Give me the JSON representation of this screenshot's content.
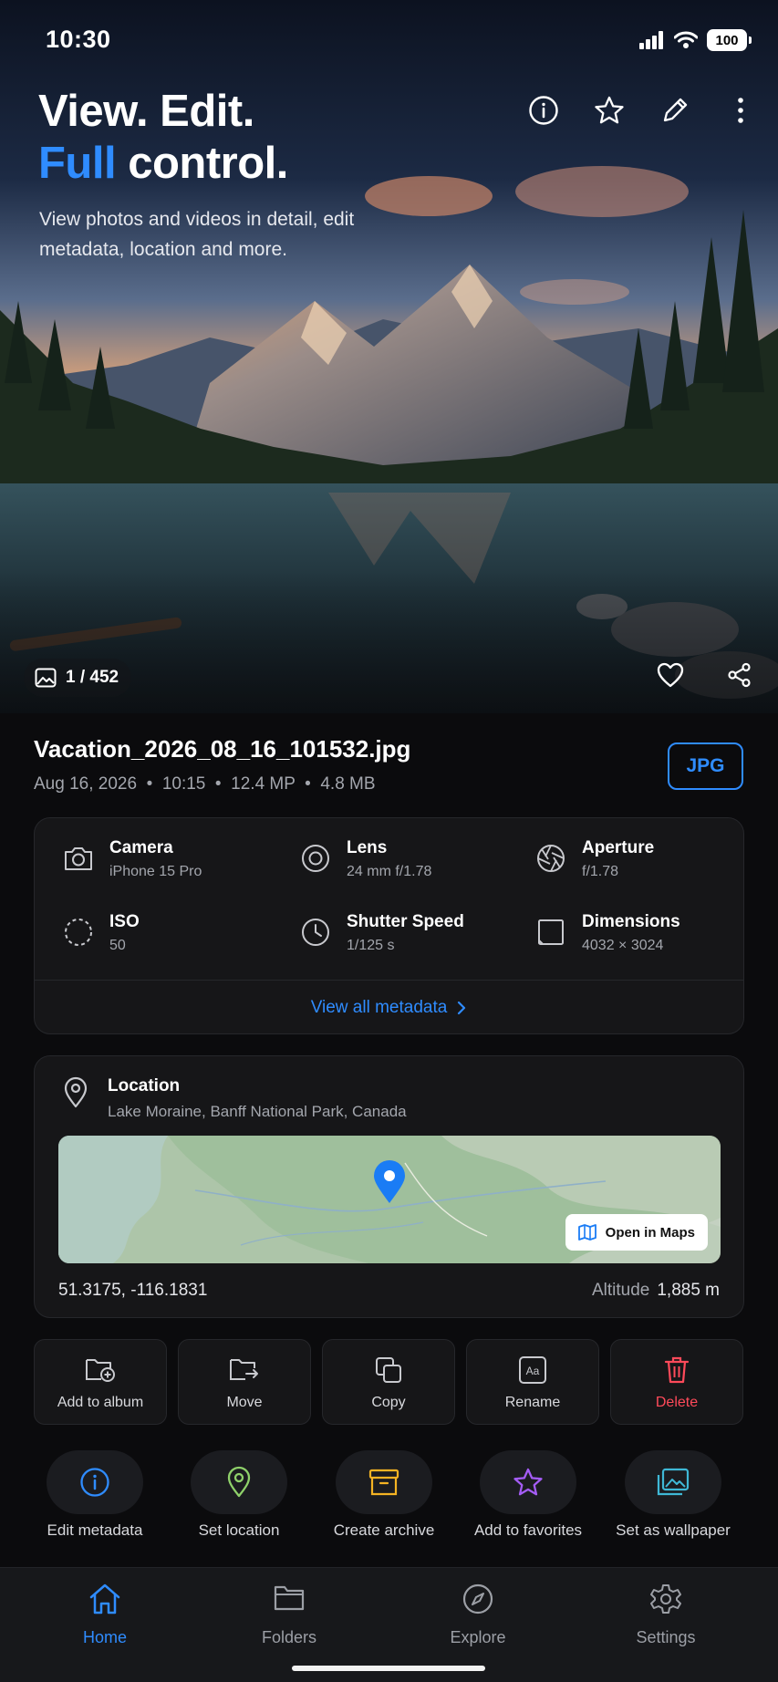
{
  "status_bar": {
    "time": "10:30",
    "battery": "100"
  },
  "hero": {
    "headline_line1": "View. Edit.",
    "headline_accent": "Full",
    "headline_rest": " control.",
    "subtitle": "View photos and videos in detail, edit metadata, location and more.",
    "counter": "1 / 452",
    "top_icons": [
      "info-icon",
      "star-icon",
      "pencil-icon",
      "more-vertical-icon"
    ],
    "bottom_icons": [
      "heart-icon",
      "share-icon"
    ]
  },
  "file": {
    "name": "Vacation_2026_08_16_101532.jpg",
    "date": "Aug 16, 2026",
    "time": "10:15",
    "megapixels": "12.4 MP",
    "size": "4.8 MB",
    "format": "JPG"
  },
  "metadata": {
    "items": [
      {
        "label": "Camera",
        "value": "iPhone 15 Pro",
        "icon": "camera-icon"
      },
      {
        "label": "Lens",
        "value": "24 mm f/1.78",
        "icon": "lens-icon"
      },
      {
        "label": "Aperture",
        "value": "f/1.78",
        "icon": "aperture-icon"
      },
      {
        "label": "ISO",
        "value": "50",
        "icon": "iso-icon"
      },
      {
        "label": "Shutter Speed",
        "value": "1/125 s",
        "icon": "clock-icon"
      },
      {
        "label": "Dimensions",
        "value": "4032 × 3024",
        "icon": "dimensions-icon"
      }
    ],
    "view_all": "View all metadata"
  },
  "location": {
    "title": "Location",
    "address": "Lake Moraine, Banff National Park, Canada",
    "open_in_maps": "Open in Maps",
    "coordinates": "51.3175, -116.1831",
    "altitude_label": "Altitude",
    "altitude_value": "1,885 m"
  },
  "actions": [
    {
      "label": "Add to album",
      "icon": "add-to-album-icon"
    },
    {
      "label": "Move",
      "icon": "move-folder-icon"
    },
    {
      "label": "Copy",
      "icon": "copy-icon"
    },
    {
      "label": "Rename",
      "icon": "rename-icon"
    },
    {
      "label": "Delete",
      "icon": "trash-icon"
    }
  ],
  "quick_actions": [
    {
      "label": "Edit metadata",
      "icon": "info-icon",
      "color": "#2f8cff"
    },
    {
      "label": "Set location",
      "icon": "location-pin-icon",
      "color": "#8fd16a"
    },
    {
      "label": "Create archive",
      "icon": "archive-icon",
      "color": "#f5b323"
    },
    {
      "label": "Add to favorites",
      "icon": "star-icon",
      "color": "#a45cf5"
    },
    {
      "label": "Set as wallpaper",
      "icon": "wallpaper-icon",
      "color": "#3fb8d6"
    }
  ],
  "tabs": [
    {
      "label": "Home",
      "icon": "home-icon",
      "active": true
    },
    {
      "label": "Folders",
      "icon": "folder-icon",
      "active": false
    },
    {
      "label": "Explore",
      "icon": "compass-icon",
      "active": false
    },
    {
      "label": "Settings",
      "icon": "gear-icon",
      "active": false
    }
  ],
  "colors": {
    "accent": "#2f8cff",
    "danger": "#ff4a5a",
    "background": "#0b0b0d",
    "card": "#161618"
  }
}
